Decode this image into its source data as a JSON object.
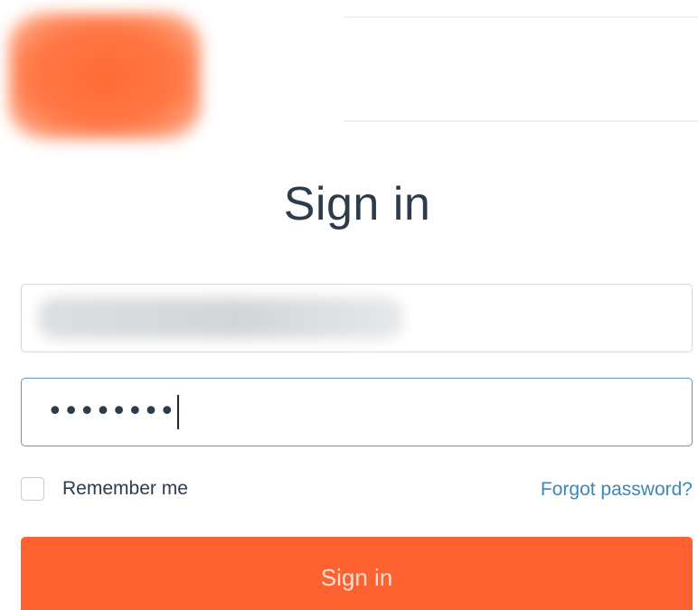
{
  "header": {
    "logo": "blurred-logo"
  },
  "form": {
    "title": "Sign in",
    "username": {
      "value_state": "blurred"
    },
    "password": {
      "masked_value": "••••••••"
    },
    "remember_label": "Remember me",
    "remember_checked": false,
    "forgot_label": "Forgot password?",
    "submit_label": "Sign in"
  },
  "colors": {
    "accent": "#fd6230",
    "link": "#3a87b8",
    "focus_border": "#5c99bd",
    "text": "#2d3c4a"
  }
}
